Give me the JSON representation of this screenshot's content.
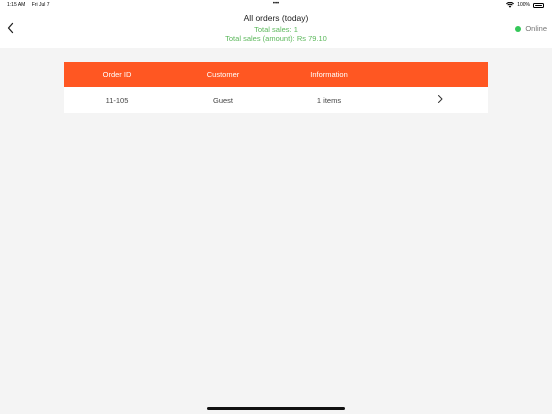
{
  "status_bar": {
    "time": "1:15 AM",
    "date": "Fri Jul 7",
    "dots": "•••",
    "battery_text": "100%"
  },
  "header": {
    "title": "All orders (today)",
    "total_sales": "Total sales: 1",
    "total_amount": "Total sales (amount): Rs 79.10",
    "online_label": "Online"
  },
  "colors": {
    "accent": "#ff5722",
    "green_text": "#5cb85c",
    "online_dot": "#34c759"
  },
  "table": {
    "columns": [
      "Order ID",
      "Customer",
      "Information",
      ""
    ],
    "rows": [
      {
        "order_id": "11-105",
        "customer": "Guest",
        "information": "1 items"
      }
    ]
  }
}
